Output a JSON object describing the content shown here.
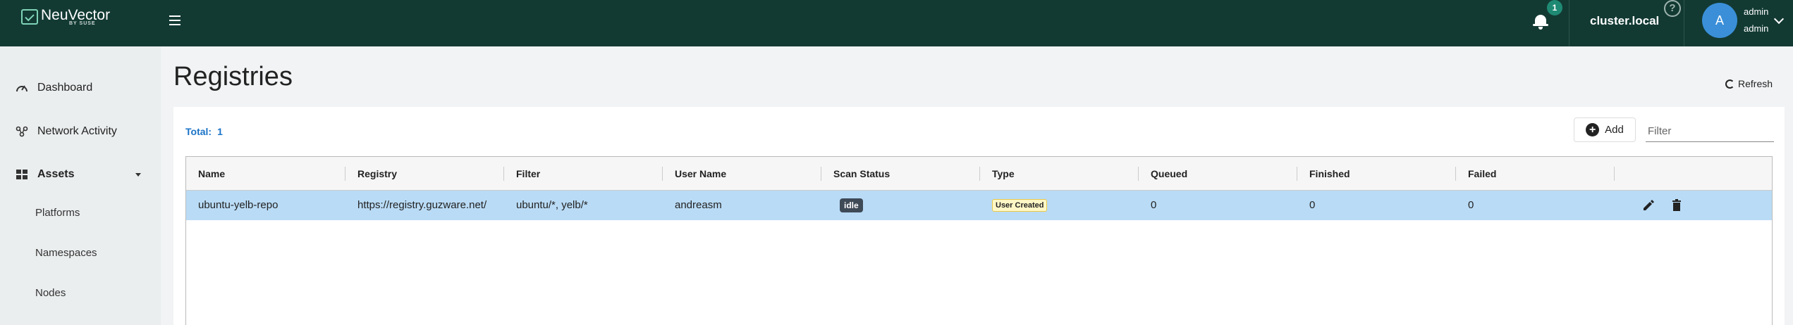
{
  "header": {
    "logo_text": "NeuVector",
    "logo_sub": "BY SUSE",
    "notifications_count": "1",
    "cluster": "cluster.local",
    "help_symbol": "?",
    "avatar_initial": "A",
    "user_name": "admin",
    "user_role": "admin"
  },
  "sidebar": {
    "items": [
      {
        "label": "Dashboard",
        "icon": "dashboard-icon"
      },
      {
        "label": "Network Activity",
        "icon": "network-icon"
      },
      {
        "label": "Assets",
        "icon": "assets-icon"
      }
    ],
    "sub_items": [
      {
        "label": "Platforms"
      },
      {
        "label": "Namespaces"
      },
      {
        "label": "Nodes"
      }
    ]
  },
  "page": {
    "title": "Registries",
    "refresh_label": "Refresh",
    "total_label": "Total:",
    "total_value": "1",
    "add_label": "Add",
    "filter_placeholder": "Filter"
  },
  "table": {
    "columns": [
      "Name",
      "Registry",
      "Filter",
      "User Name",
      "Scan Status",
      "Type",
      "Queued",
      "Finished",
      "Failed"
    ],
    "rows": [
      {
        "name": "ubuntu-yelb-repo",
        "registry": "https://registry.guzware.net/",
        "filter": "ubuntu/*, yelb/*",
        "user_name": "andreasm",
        "scan_status": "idle",
        "type": "User Created",
        "queued": "0",
        "finished": "0",
        "failed": "0"
      }
    ]
  },
  "colors": {
    "topbar": "#123a33",
    "accent": "#1a73c8",
    "row_selected": "#b9dbf6"
  }
}
